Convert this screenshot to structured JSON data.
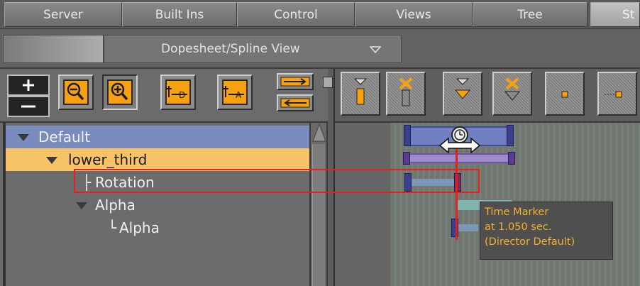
{
  "tabs": [
    {
      "label": "Server",
      "active": false
    },
    {
      "label": "Built Ins",
      "active": false
    },
    {
      "label": "Control",
      "active": false
    },
    {
      "label": "Views",
      "active": false
    },
    {
      "label": "Tree",
      "active": false
    },
    {
      "label": "St",
      "active": true
    }
  ],
  "header": {
    "view_selector": "Dopesheet/Spline View"
  },
  "toolbar_left": {
    "buttons": [
      {
        "name": "plus",
        "glyph": "+"
      },
      {
        "name": "minus",
        "glyph": "−"
      },
      {
        "name": "zoom-out",
        "glyph": "Q"
      },
      {
        "name": "zoom-in",
        "glyph": "Q"
      },
      {
        "name": "add-director",
        "glyph": "+D"
      },
      {
        "name": "add-action",
        "glyph": "+A"
      }
    ]
  },
  "tree": {
    "rows": [
      {
        "label": "Default",
        "expanded": true,
        "selected_color": "#7a8cbe"
      },
      {
        "label": "lower_third",
        "expanded": true,
        "selected_color": "#f8c266"
      },
      {
        "label": "Rotation",
        "prefix": "├"
      },
      {
        "label": "Alpha",
        "expanded": true
      },
      {
        "label": "Alpha",
        "prefix": "└"
      }
    ]
  },
  "tooltip": {
    "line1": "Time Marker",
    "line2": "at 1.050 sec.",
    "line3": "(Director Default)"
  },
  "colors": {
    "director_track": "#6f7fbf",
    "container_track": "#a08bc9",
    "lower_third_highlight": "#f8c266",
    "time_marker": "#e02020",
    "tooltip_text": "#f6b12a",
    "annotation_box": "#e3211d"
  }
}
